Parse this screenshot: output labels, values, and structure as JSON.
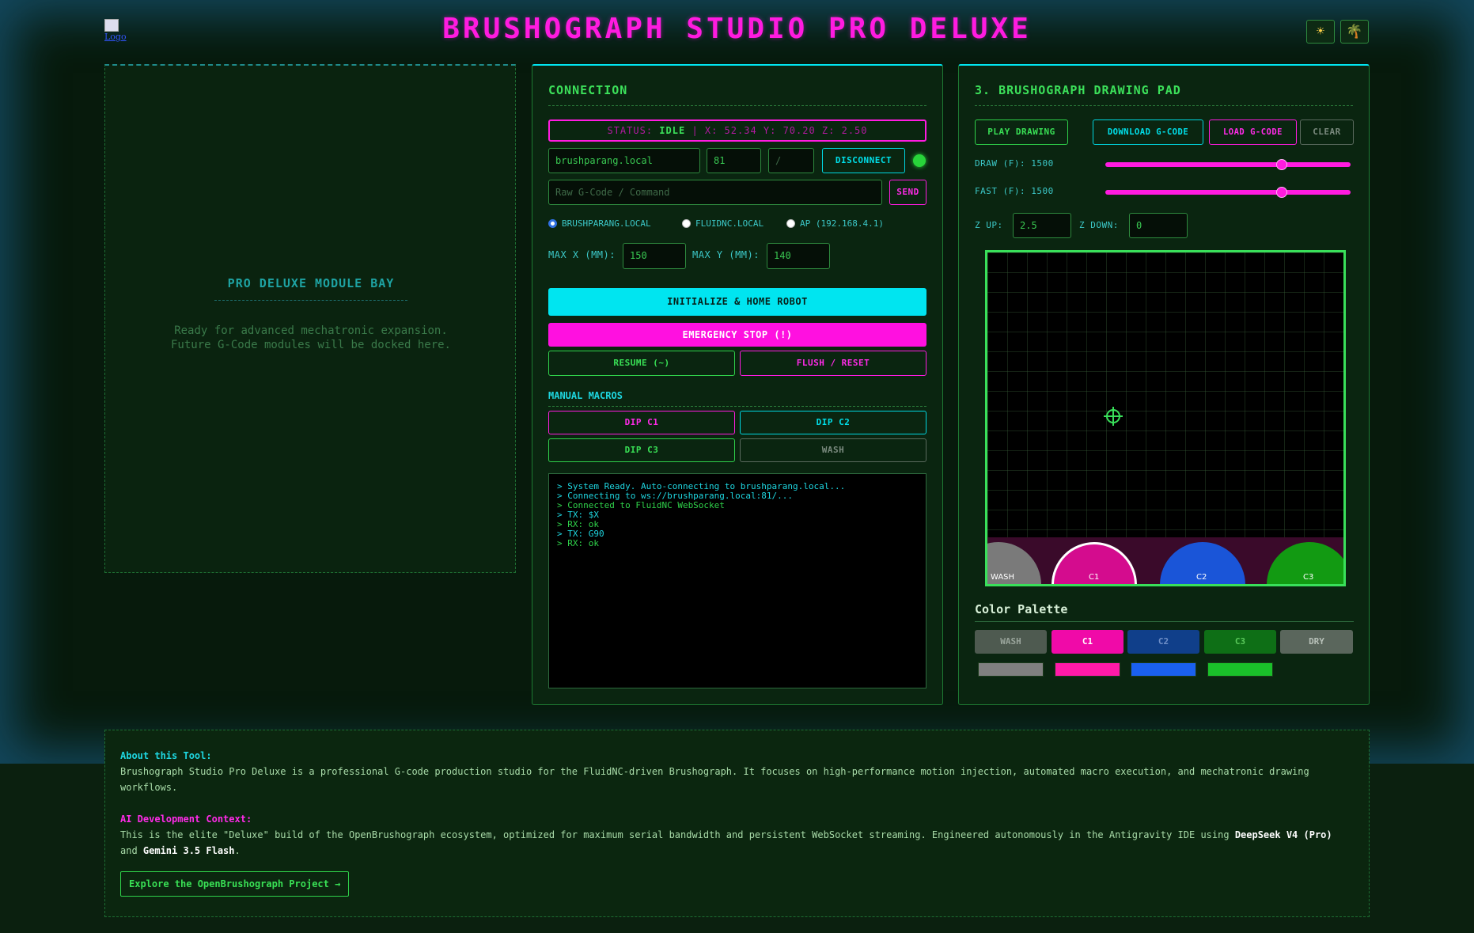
{
  "header": {
    "title": "BRUSHOGRAPH STUDIO PRO DELUXE",
    "logo_alt": "Logo",
    "theme_icon": "sun-icon",
    "palm_icon": "palm-tree-icon"
  },
  "bay": {
    "title": "PRO DELUXE MODULE BAY",
    "line1": "Ready for advanced mechatronic expansion.",
    "line2": "Future G-Code modules will be docked here."
  },
  "connection": {
    "title": "CONNECTION",
    "status_label": "STATUS:",
    "status_value": "IDLE",
    "status_coords": "| X: 52.34 Y: 70.20 Z: 2.50",
    "host": "brushparang.local",
    "port": "81",
    "path": "/",
    "disconnect_label": "DISCONNECT",
    "raw_placeholder": "Raw G-Code / Command",
    "send_label": "SEND",
    "radios": [
      {
        "label": "BRUSHPARANG.LOCAL",
        "checked": true
      },
      {
        "label": "FLUIDNC.LOCAL",
        "checked": false
      },
      {
        "label": "AP (192.168.4.1)",
        "checked": false
      }
    ],
    "max_x_label": "MAX X (MM):",
    "max_x": "150",
    "max_y_label": "MAX Y (MM):",
    "max_y": "140",
    "init_label": "INITIALIZE & HOME ROBOT",
    "estop_label": "EMERGENCY STOP (!)",
    "resume_label": "RESUME (~)",
    "flush_label": "FLUSH / RESET",
    "macros_title": "MANUAL MACROS",
    "macros": {
      "c1": "DIP C1",
      "c2": "DIP C2",
      "c3": "DIP C3",
      "wash": "WASH"
    },
    "console": [
      "> System Ready. Auto-connecting to brushparang.local...",
      "> Connecting to ws://brushparang.local:81/...",
      "> Connected to FluidNC WebSocket",
      "> TX: $X",
      "> RX: ok",
      "> TX: G90",
      "> RX: ok"
    ],
    "colors": {
      "cyan": "#00e5f0",
      "magenta": "#ff1be0",
      "green": "#39e055"
    }
  },
  "pad": {
    "title": "3. BRUSHOGRAPH DRAWING PAD",
    "play_label": "PLAY DRAWING",
    "download_label": "DOWNLOAD G-CODE",
    "load_label": "LOAD G-CODE",
    "clear_label": "CLEAR",
    "draw_label": "DRAW (F): 1500",
    "fast_label": "FAST (F): 1500",
    "draw_level": 0.73,
    "fast_level": 0.73,
    "zup_label": "Z UP:",
    "zup": "2.5",
    "zdown_label": "Z DOWN:",
    "zdown": "0",
    "wells": [
      {
        "label": "WASH",
        "color": "#7a7a7a"
      },
      {
        "label": "C1",
        "color": "#d40c8e"
      },
      {
        "label": "C2",
        "color": "#1a55d8"
      },
      {
        "label": "C3",
        "color": "#129a12"
      }
    ],
    "palette_title": "Color Palette",
    "palette": [
      {
        "label": "WASH",
        "bg": "#4e5a50",
        "fg": "#9aa59c"
      },
      {
        "label": "C1",
        "bg": "#f00aa8",
        "fg": "#ffffff"
      },
      {
        "label": "C2",
        "bg": "#103f8a",
        "fg": "#6f8fc8"
      },
      {
        "label": "C3",
        "bg": "#0e6f16",
        "fg": "#5ac85a"
      },
      {
        "label": "DRY",
        "bg": "#5a665c",
        "fg": "#b7c0b8"
      }
    ],
    "swatches": [
      "#808080",
      "#ff1aa8",
      "#1a60f0",
      "#1ac02a"
    ]
  },
  "about": {
    "h1": "About this Tool:",
    "p1": "Brushograph Studio Pro Deluxe is a professional G-code production studio for the FluidNC-driven Brushograph. It focuses on high-performance motion injection, automated macro execution, and mechatronic drawing workflows.",
    "h2": "AI Development Context:",
    "p2a": "This is the elite \"Deluxe\" build of the OpenBrushograph ecosystem, optimized for maximum serial bandwidth and persistent WebSocket streaming. Engineered autonomously in the Antigravity IDE using ",
    "p2b": "DeepSeek V4 (Pro)",
    "p2c": " and ",
    "p2d": "Gemini 3.5 Flash",
    "p2e": ".",
    "explore_label": "Explore the OpenBrushograph Project →"
  }
}
